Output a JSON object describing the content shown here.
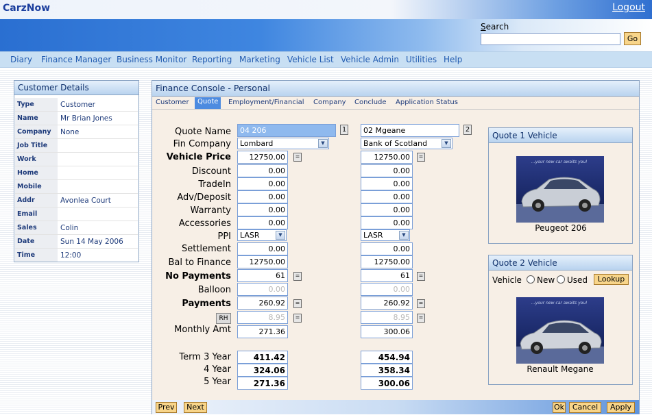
{
  "app": {
    "logo": "CarzNow",
    "logout": "Logout"
  },
  "search": {
    "label": "Search",
    "go": "Go",
    "value": ""
  },
  "nav": [
    "Diary",
    "Finance Manager",
    "Business Monitor",
    "Reporting",
    "Marketing",
    "Vehicle List",
    "Vehicle Admin",
    "Utilities",
    "Help"
  ],
  "customer": {
    "title": "Customer Details",
    "rows": [
      {
        "label": "Type",
        "value": "Customer"
      },
      {
        "label": "Name",
        "value": "Mr Brian Jones"
      },
      {
        "label": "Company",
        "value": "None"
      },
      {
        "label": "Job Title",
        "value": ""
      },
      {
        "label": "Work",
        "value": ""
      },
      {
        "label": "Home",
        "value": ""
      },
      {
        "label": "Mobile",
        "value": ""
      },
      {
        "label": "Addr",
        "value": "Avonlea Court"
      },
      {
        "label": "Email",
        "value": ""
      },
      {
        "label": "Sales",
        "value": "Colin"
      },
      {
        "label": "Date",
        "value": "Sun 14 May 2006"
      },
      {
        "label": "Time",
        "value": "12:00"
      }
    ]
  },
  "console": {
    "title": "Finance Console - Personal",
    "tabs": [
      "Customer",
      "Quote",
      "Employment/Financial",
      "Company",
      "Conclude",
      "Application Status"
    ],
    "active_tab": "Quote",
    "labels": {
      "quote_name": "Quote Name",
      "fin_company": "Fin Company",
      "vehicle_price": "Vehicle Price",
      "discount": "Discount",
      "tradein": "TradeIn",
      "adv_deposit": "Adv/Deposit",
      "warranty": "Warranty",
      "accessories": "Accessories",
      "ppi": "PPI",
      "settlement": "Settlement",
      "bal_to_finance": "Bal to Finance",
      "no_payments": "No Payments",
      "balloon": "Balloon",
      "payments": "Payments",
      "rh": "RH",
      "monthly_amt": "Monthly Amt",
      "term_3": "Term 3 Year",
      "term_4": "4 Year",
      "term_5": "5 Year"
    },
    "quote1": {
      "number": "1",
      "quote_name": "04 206",
      "fin_company": "Lombard",
      "vehicle_price": "12750.00",
      "discount": "0.00",
      "tradein": "0.00",
      "adv_deposit": "0.00",
      "warranty": "0.00",
      "accessories": "0.00",
      "ppi": "LASR",
      "settlement": "0.00",
      "bal_to_finance": "12750.00",
      "no_payments": "61",
      "balloon": "0.00",
      "payments": "260.92",
      "rh_value": "8.95",
      "monthly_amt": "271.36",
      "term_3": "411.42",
      "term_4": "324.06",
      "term_5": "271.36"
    },
    "quote2": {
      "number": "2",
      "quote_name": "02 Mgeane",
      "fin_company": "Bank of Scotland",
      "vehicle_price": "12750.00",
      "discount": "0.00",
      "tradein": "0.00",
      "adv_deposit": "0.00",
      "warranty": "0.00",
      "accessories": "0.00",
      "ppi": "LASR",
      "settlement": "0.00",
      "bal_to_finance": "12750.00",
      "no_payments": "61",
      "balloon": "0.00",
      "payments": "260.92",
      "rh_value": "8.95",
      "monthly_amt": "300.06",
      "term_3": "454.94",
      "term_4": "358.34",
      "term_5": "300.06"
    },
    "vehicle1": {
      "title": "Quote 1 Vehicle",
      "name": "Peugeot 206",
      "banner": "...your new car awaits you!"
    },
    "vehicle2": {
      "title": "Quote 2 Vehicle",
      "vehicle_label": "Vehicle",
      "new_label": "New",
      "used_label": "Used",
      "lookup": "Lookup",
      "name": "Renault Megane",
      "banner": "...your new car awaits you!"
    },
    "buttons": {
      "prev": "Prev",
      "next": "Next",
      "ok": "Ok",
      "cancel": "Cancel",
      "apply": "Apply"
    }
  },
  "colors": {
    "accent": "#4d8be0",
    "panel_bg": "#f7efe6",
    "button_bg": "#f8d58a",
    "link": "#215bb0"
  }
}
